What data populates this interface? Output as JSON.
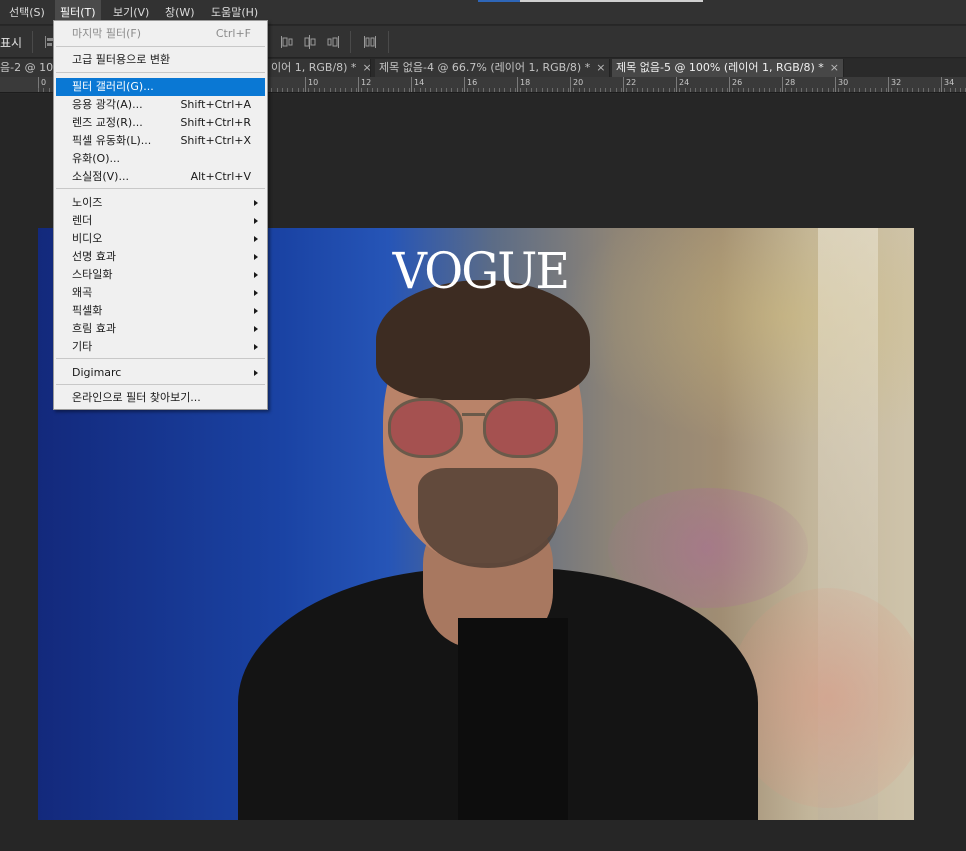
{
  "menubar": {
    "items": [
      {
        "label": "선택(S)"
      },
      {
        "label": "필터(T)"
      },
      {
        "label": "보기(V)"
      },
      {
        "label": "창(W)"
      },
      {
        "label": "도움말(H)"
      }
    ]
  },
  "options": {
    "show_label": "표시"
  },
  "tabs": [
    {
      "label": "음-2 @ 10"
    },
    {
      "label": "이어 1, RGB/8) *"
    },
    {
      "label": "제목 없음-4 @ 66.7% (레이어 1, RGB/8) *"
    },
    {
      "label": "제목 없음-5 @ 100% (레이어 1, RGB/8) *"
    }
  ],
  "ruler": {
    "labels": [
      "0",
      "10",
      "12",
      "14",
      "16",
      "18",
      "20",
      "22",
      "24",
      "26",
      "28",
      "30",
      "32",
      "34"
    ]
  },
  "filter_menu": {
    "items": [
      {
        "label": "마지막 필터(F)",
        "shortcut": "Ctrl+F"
      },
      {
        "label": "고급 필터용으로 변환"
      },
      {
        "label": "필터 갤러리(G)..."
      },
      {
        "label": "응용 광각(A)...",
        "shortcut": "Shift+Ctrl+A"
      },
      {
        "label": "렌즈 교정(R)...",
        "shortcut": "Shift+Ctrl+R"
      },
      {
        "label": "픽셀 유동화(L)...",
        "shortcut": "Shift+Ctrl+X"
      },
      {
        "label": "유화(O)..."
      },
      {
        "label": "소실점(V)...",
        "shortcut": "Alt+Ctrl+V"
      },
      {
        "label": "노이즈"
      },
      {
        "label": "렌더"
      },
      {
        "label": "비디오"
      },
      {
        "label": "선명 효과"
      },
      {
        "label": "스타일화"
      },
      {
        "label": "왜곡"
      },
      {
        "label": "픽셀화"
      },
      {
        "label": "흐림 효과"
      },
      {
        "label": "기타"
      },
      {
        "label": "Digimarc"
      },
      {
        "label": "온라인으로 필터 찾아보기..."
      }
    ]
  },
  "canvas": {
    "watermark_text": "VOGUE"
  },
  "colors": {
    "menu_highlight": "#0a78d4",
    "panel_bg": "#323232",
    "canvas_bg": "#262626"
  }
}
